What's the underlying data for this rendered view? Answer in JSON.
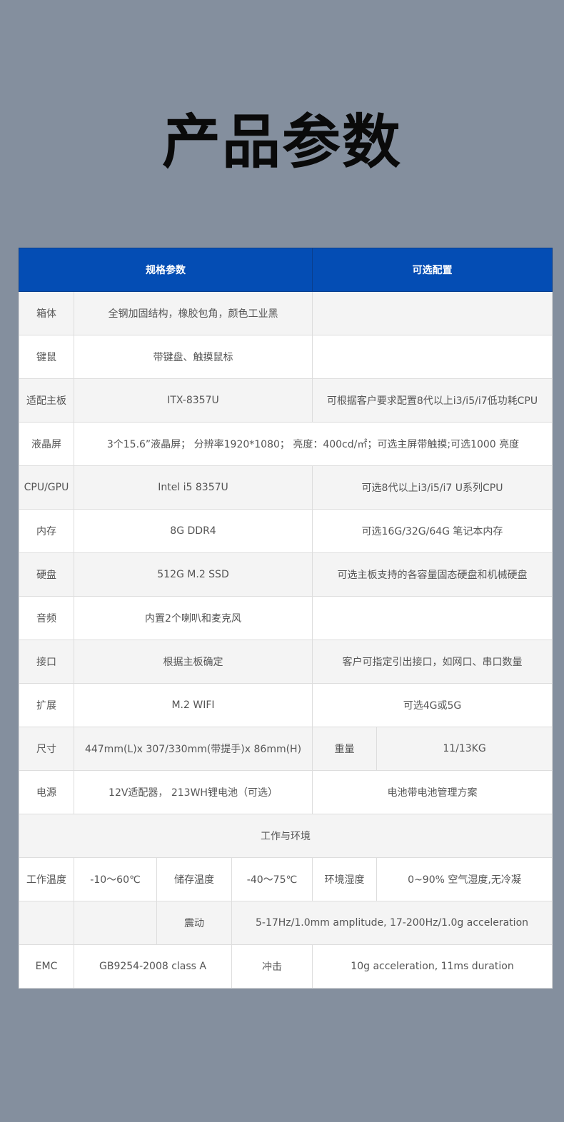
{
  "title": "产品参数",
  "colors": {
    "header_bg": "#044db4",
    "page_bg": "#848f9e",
    "row_alt": "#f4f4f4"
  },
  "header": {
    "spec": "规格参数",
    "options": "可选配置"
  },
  "rows": {
    "chassis": {
      "label": "箱体",
      "value": "全钢加固结构，橡胶包角，颜色工业黑",
      "option": ""
    },
    "keyboard": {
      "label": "键鼠",
      "value": "带键盘、触摸鼠标",
      "option": ""
    },
    "board": {
      "label": "适配主板",
      "value": "ITX-8357U",
      "option": "可根据客户要求配置8代以上i3/i5/i7低功耗CPU"
    },
    "lcd": {
      "label": "液晶屏",
      "value": "3个15.6”液晶屏； 分辨率1920*1080； 亮度：400cd/㎡；可选主屏带触摸;可选1000 亮度"
    },
    "cpu": {
      "label": "CPU/GPU",
      "value": "Intel i5 8357U",
      "option": "可选8代以上i3/i5/i7 U系列CPU"
    },
    "memory": {
      "label": "内存",
      "value": "8G DDR4",
      "option": "可选16G/32G/64G 笔记本内存"
    },
    "disk": {
      "label": "硬盘",
      "value": "512G M.2 SSD",
      "option": "可选主板支持的各容量固态硬盘和机械硬盘"
    },
    "audio": {
      "label": "音频",
      "value": "内置2个喇叭和麦克风",
      "option": ""
    },
    "ports": {
      "label": "接口",
      "value": "根据主板确定",
      "option": "客户可指定引出接口，如网口、串口数量"
    },
    "expansion": {
      "label": "扩展",
      "value": "M.2 WIFI",
      "option": "可选4G或5G"
    },
    "size": {
      "label": "尺寸",
      "value": "447mm(L)x 307/330mm(带提手)x 86mm(H)",
      "weight_label": "重量",
      "weight_value": "11/13KG"
    },
    "power": {
      "label": "电源",
      "value": "12V适配器， 213WH锂电池（可选）",
      "option": "电池带电池管理方案"
    }
  },
  "environment": {
    "section_title": "工作与环境",
    "work_temp_label": "工作温度",
    "work_temp_value": "-10～60℃",
    "storage_temp_label": "储存温度",
    "storage_temp_value": "-40～75℃",
    "humidity_label": "环境湿度",
    "humidity_value": "0~90% 空气湿度,无冷凝",
    "vibration_label": "震动",
    "vibration_value": "5-17Hz/1.0mm amplitude, 17-200Hz/1.0g acceleration",
    "emc_label": "EMC",
    "emc_value": "GB9254-2008 class A",
    "shock_label": "冲击",
    "shock_value": "10g acceleration, 11ms duration"
  }
}
